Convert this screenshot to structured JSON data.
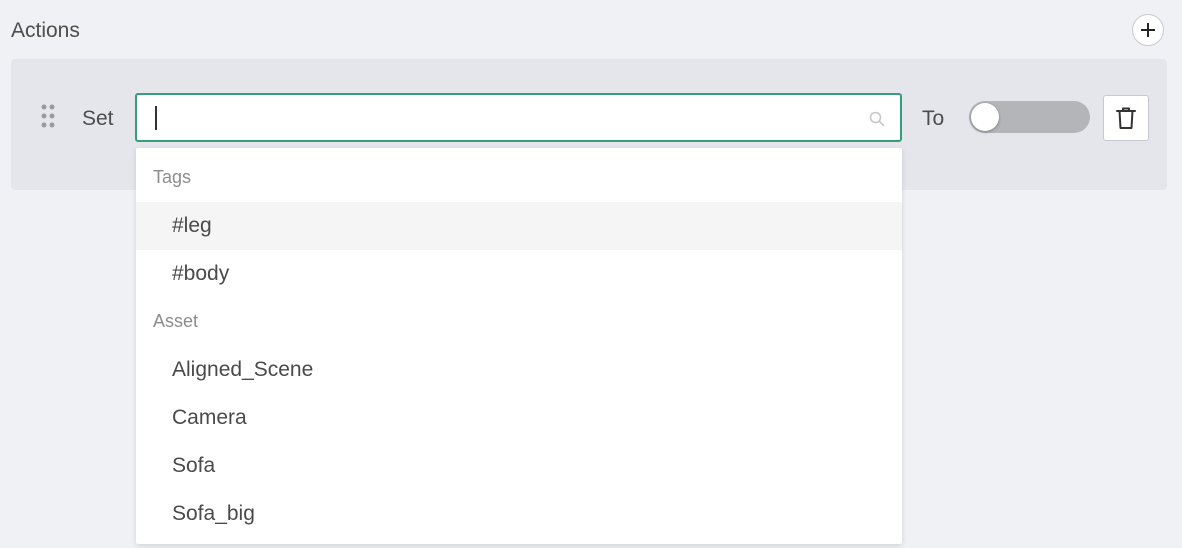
{
  "section": {
    "title": "Actions"
  },
  "action_row": {
    "set_label": "Set",
    "search": {
      "value": "",
      "placeholder": ""
    },
    "to_label": "To",
    "toggle": {
      "state": "off"
    }
  },
  "dropdown": {
    "groups": [
      {
        "header": "Tags",
        "options": [
          "#leg",
          "#body"
        ]
      },
      {
        "header": "Asset",
        "options": [
          "Aligned_Scene",
          "Camera",
          "Sofa",
          "Sofa_big"
        ]
      }
    ],
    "highlighted_option": "#leg"
  },
  "icons": {
    "add": "plus-icon",
    "drag": "drag-handle-icon",
    "search": "search-icon",
    "delete": "trash-icon"
  },
  "colors": {
    "focus_border": "#3a9d7a",
    "panel_bg": "#e4e6ec",
    "page_bg": "#f0f1f4",
    "toggle_off": "#b4b5b8"
  }
}
